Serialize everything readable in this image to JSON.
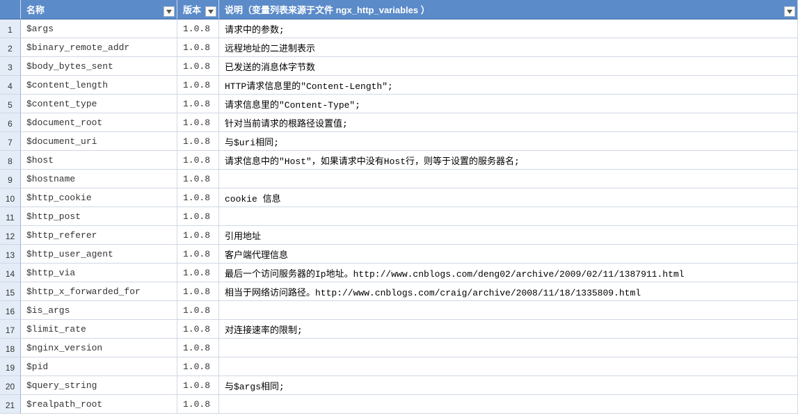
{
  "headers": {
    "name": "名称",
    "version": "版本",
    "description": "说明（变量列表来源于文件 ngx_http_variables ）"
  },
  "rows": [
    {
      "num": "1",
      "name": "$args",
      "ver": "1.0.8",
      "desc": "请求中的参数;"
    },
    {
      "num": "2",
      "name": "$binary_remote_addr",
      "ver": "1.0.8",
      "desc": "远程地址的二进制表示"
    },
    {
      "num": "3",
      "name": "$body_bytes_sent",
      "ver": "1.0.8",
      "desc": "已发送的消息体字节数"
    },
    {
      "num": "4",
      "name": "$content_length",
      "ver": "1.0.8",
      "desc": "HTTP请求信息里的\"Content-Length\";"
    },
    {
      "num": "5",
      "name": "$content_type",
      "ver": "1.0.8",
      "desc": "请求信息里的\"Content-Type\";"
    },
    {
      "num": "6",
      "name": "$document_root",
      "ver": "1.0.8",
      "desc": "针对当前请求的根路径设置值;"
    },
    {
      "num": "7",
      "name": "$document_uri",
      "ver": "1.0.8",
      "desc": "与$uri相同;"
    },
    {
      "num": "8",
      "name": "$host",
      "ver": "1.0.8",
      "desc": "请求信息中的\"Host\"，如果请求中没有Host行，则等于设置的服务器名;"
    },
    {
      "num": "9",
      "name": "$hostname",
      "ver": "1.0.8",
      "desc": ""
    },
    {
      "num": "10",
      "name": "$http_cookie",
      "ver": "1.0.8",
      "desc": "cookie 信息"
    },
    {
      "num": "11",
      "name": "$http_post",
      "ver": "1.0.8",
      "desc": ""
    },
    {
      "num": "12",
      "name": "$http_referer",
      "ver": "1.0.8",
      "desc": "引用地址"
    },
    {
      "num": "13",
      "name": "$http_user_agent",
      "ver": "1.0.8",
      "desc": "客户端代理信息"
    },
    {
      "num": "14",
      "name": "$http_via",
      "ver": "1.0.8",
      "desc": "最后一个访问服务器的Ip地址。http://www.cnblogs.com/deng02/archive/2009/02/11/1387911.html"
    },
    {
      "num": "15",
      "name": "$http_x_forwarded_for",
      "ver": "1.0.8",
      "desc": "相当于网络访问路径。http://www.cnblogs.com/craig/archive/2008/11/18/1335809.html"
    },
    {
      "num": "16",
      "name": "$is_args",
      "ver": "1.0.8",
      "desc": ""
    },
    {
      "num": "17",
      "name": "$limit_rate",
      "ver": "1.0.8",
      "desc": "对连接速率的限制;"
    },
    {
      "num": "18",
      "name": "$nginx_version",
      "ver": "1.0.8",
      "desc": ""
    },
    {
      "num": "19",
      "name": "$pid",
      "ver": "1.0.8",
      "desc": ""
    },
    {
      "num": "20",
      "name": "$query_string",
      "ver": "1.0.8",
      "desc": "与$args相同;"
    },
    {
      "num": "21",
      "name": "$realpath_root",
      "ver": "1.0.8",
      "desc": ""
    }
  ]
}
